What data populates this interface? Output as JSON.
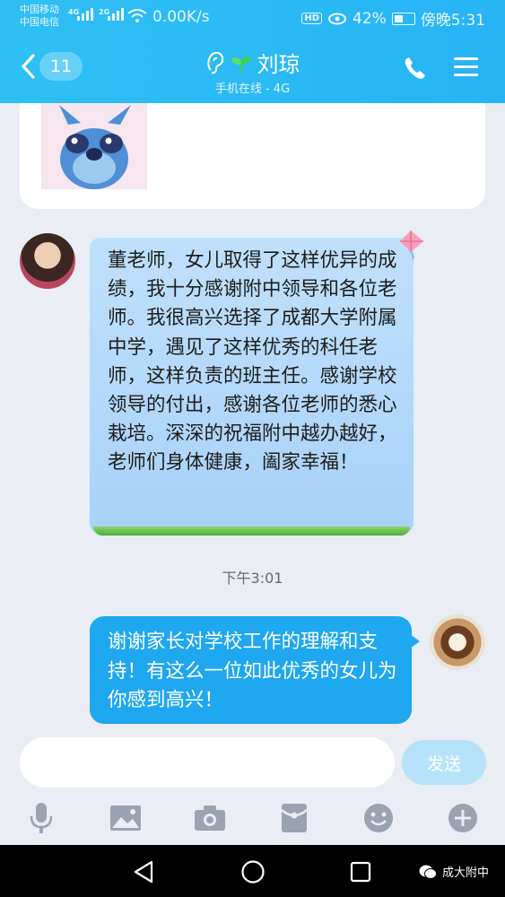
{
  "status_bar": {
    "carrier1": "中国移动",
    "carrier2": "中国电信",
    "net1": "4G",
    "net2": "2G",
    "speed": "0.00K/s",
    "hd": "HD",
    "battery": "42%",
    "time": "傍晚5:31"
  },
  "header": {
    "back_badge": "11",
    "contact_name": "刘琼",
    "contact_status": "手机在线 - 4G"
  },
  "messages": {
    "received_text": "董老师，女儿取得了这样优异的成绩，我十分感谢附中领导和各位老师。我很高兴选择了成都大学附属中学，遇见了这样优秀的科任老师，这样负责的班主任。感谢学校领导的付出，感谢各位老师的悉心栽培。深深的祝福附中越办越好，老师们身体健康，阖家幸福！",
    "timestamp": "下午3:01",
    "sent_text": "谢谢家长对学校工作的理解和支持！有这么一位如此优秀的女儿为你感到高兴！"
  },
  "input": {
    "value": "",
    "send_label": "发送"
  },
  "toolbar": {
    "icons": [
      "microphone-icon",
      "image-icon",
      "camera-icon",
      "red-packet-icon",
      "emoji-icon",
      "plus-icon"
    ]
  },
  "watermark": {
    "text": "成大附中"
  },
  "colors": {
    "header": "#27b4f5",
    "sent_bubble": "#1fa7ef",
    "received_bubble": "#b4d8fa",
    "send_button": "#b6e3f9"
  }
}
